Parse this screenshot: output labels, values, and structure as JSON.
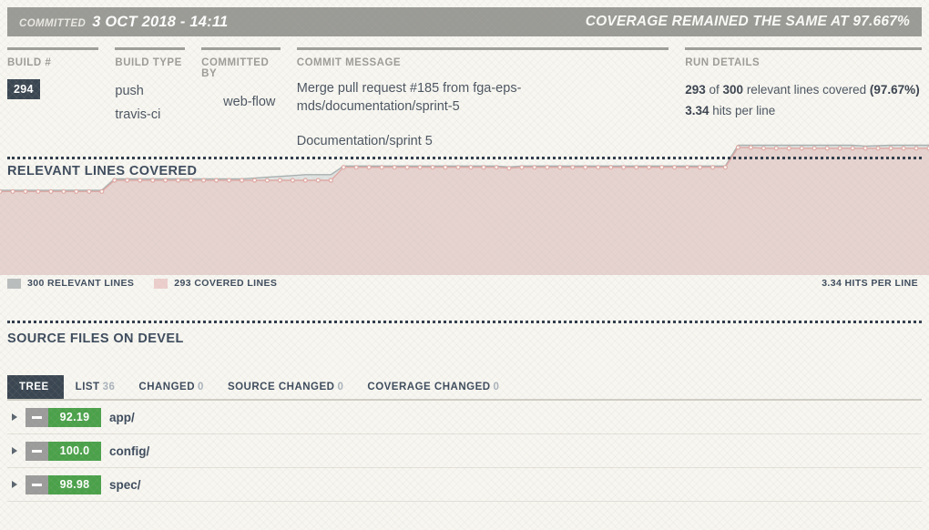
{
  "header": {
    "committed_label": "COMMITTED",
    "committed_datetime": "3 OCT 2018 - 14:11",
    "coverage_status": "COVERAGE REMAINED THE SAME AT 97.667%"
  },
  "info_columns": {
    "build": {
      "header": "BUILD #",
      "value": "294"
    },
    "build_type": {
      "header": "BUILD TYPE",
      "value1": "push",
      "value2": "travis-ci"
    },
    "committed_by": {
      "header": "COMMITTED BY",
      "user": "web-flow",
      "avatar": "identicon-avatar"
    },
    "commit_message": {
      "header": "COMMIT MESSAGE",
      "line1": "Merge pull request #185 from fga-eps-mds/documentation/sprint-5",
      "line2": "Documentation/sprint 5"
    },
    "run_details": {
      "header": "RUN DETAILS",
      "covered": "293",
      "of_label": "of",
      "relevant": "300",
      "lines_label": "relevant lines covered",
      "percent": "(97.67%)",
      "hits": "3.34",
      "hits_label": "hits per line"
    }
  },
  "chart_section": {
    "title": "RELEVANT LINES COVERED",
    "legend_relevant": "300 RELEVANT LINES",
    "legend_covered": "293 COVERED LINES",
    "legend_hits": "3.34 HITS PER LINE"
  },
  "chart_data": {
    "type": "area",
    "title": "RELEVANT LINES COVERED",
    "xlabel": "",
    "ylabel": "",
    "grid": false,
    "legend_position": "bottom-left",
    "colors": {
      "relevant_line": "#a8b0b0",
      "relevant_fill": "#dfe3e1",
      "covered_line": "#e0a9a5",
      "covered_fill": "#e6d3d0"
    },
    "series": [
      {
        "name": "300 RELEVANT LINES",
        "values": [
          196,
          196,
          196,
          196,
          196,
          196,
          196,
          196,
          196,
          222,
          222,
          222,
          222,
          222,
          222,
          222,
          222,
          222,
          222,
          222,
          224,
          226,
          228,
          230,
          232,
          232,
          232,
          252,
          252,
          252,
          252,
          252,
          252,
          252,
          252,
          252,
          252,
          252,
          252,
          252,
          250,
          252,
          252,
          252,
          252,
          252,
          252,
          252,
          252,
          252,
          252,
          252,
          252,
          252,
          252,
          252,
          252,
          252,
          300,
          300,
          300,
          300,
          300,
          300,
          300,
          300,
          300,
          300,
          298,
          299,
          300,
          300,
          300,
          300
        ]
      },
      {
        "name": "293 COVERED LINES",
        "values": [
          193,
          193,
          193,
          193,
          193,
          193,
          193,
          193,
          193,
          219,
          219,
          219,
          219,
          219,
          219,
          219,
          219,
          219,
          219,
          219,
          219,
          219,
          219,
          219,
          219,
          219,
          219,
          249,
          249,
          249,
          249,
          249,
          249,
          249,
          249,
          249,
          249,
          249,
          249,
          249,
          247,
          249,
          249,
          249,
          249,
          249,
          249,
          249,
          249,
          249,
          249,
          249,
          249,
          249,
          249,
          249,
          249,
          249,
          295,
          295,
          293,
          293,
          293,
          293,
          293,
          293,
          293,
          293,
          293,
          293,
          293,
          293,
          293,
          293
        ]
      }
    ],
    "ylim": [
      0,
      320
    ]
  },
  "files_section": {
    "title": "SOURCE FILES ON DEVEL",
    "tabs": [
      {
        "label": "TREE",
        "count": "",
        "active": true
      },
      {
        "label": "LIST",
        "count": "36",
        "active": false
      },
      {
        "label": "CHANGED",
        "count": "0",
        "active": false
      },
      {
        "label": "SOURCE CHANGED",
        "count": "0",
        "active": false
      },
      {
        "label": "COVERAGE CHANGED",
        "count": "0",
        "active": false
      }
    ],
    "rows": [
      {
        "coverage": "92.19",
        "name": "app/",
        "change": "no-change"
      },
      {
        "coverage": "100.0",
        "name": "config/",
        "change": "no-change"
      },
      {
        "coverage": "98.98",
        "name": "spec/",
        "change": "no-change"
      }
    ]
  }
}
